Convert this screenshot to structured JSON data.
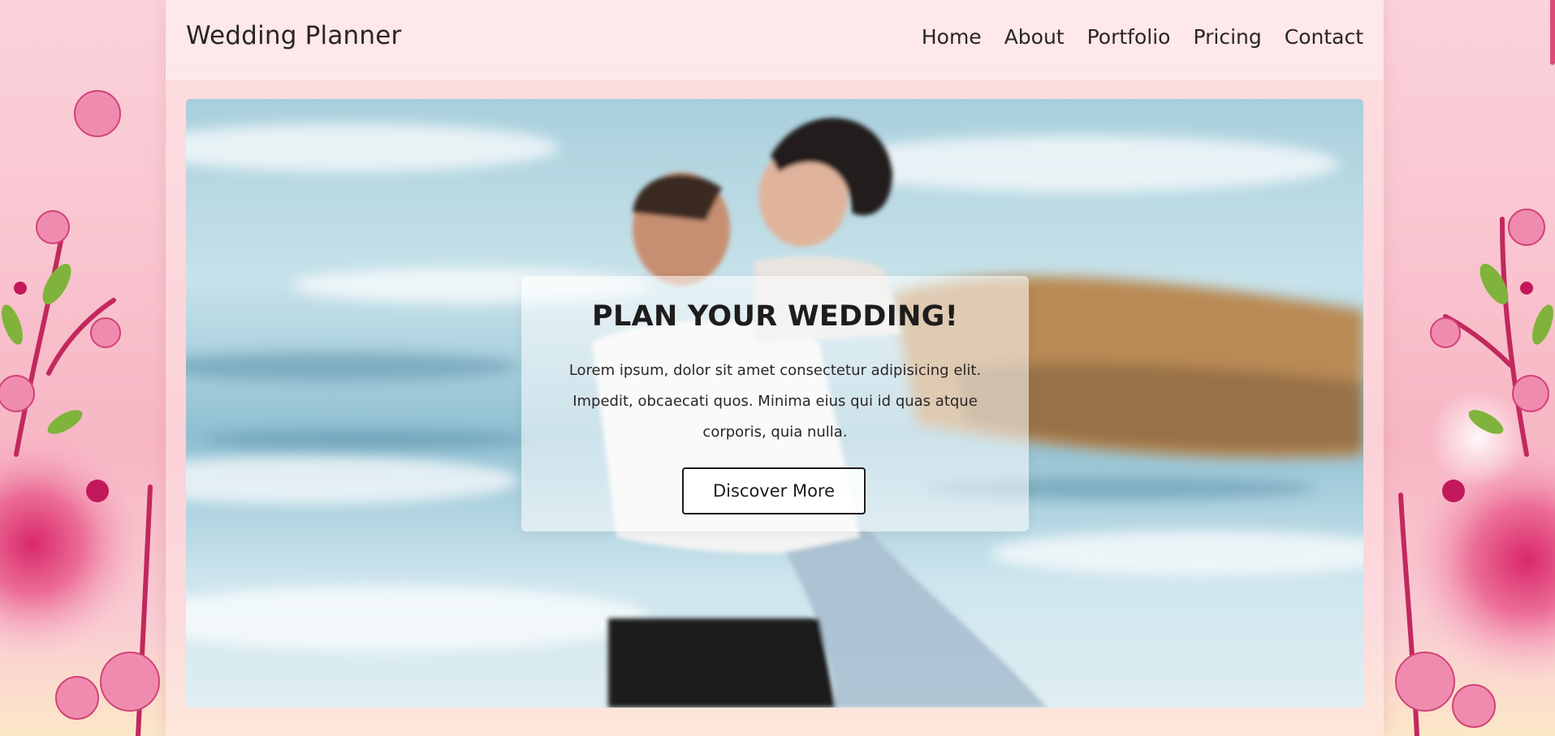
{
  "header": {
    "brand": "Wedding Planner",
    "nav": [
      "Home",
      "About",
      "Portfolio",
      "Pricing",
      "Contact"
    ]
  },
  "hero": {
    "title": "PLAN YOUR WEDDING!",
    "text": "Lorem ipsum, dolor sit amet consectetur adipisicing elit. Impedit, obcaecati quos. Minima eius qui id quas atque corporis, quia nulla.",
    "button": "Discover More"
  },
  "colors": {
    "text": "#2a2526",
    "accent": "#e04a78",
    "background": "#f9c4cf"
  }
}
